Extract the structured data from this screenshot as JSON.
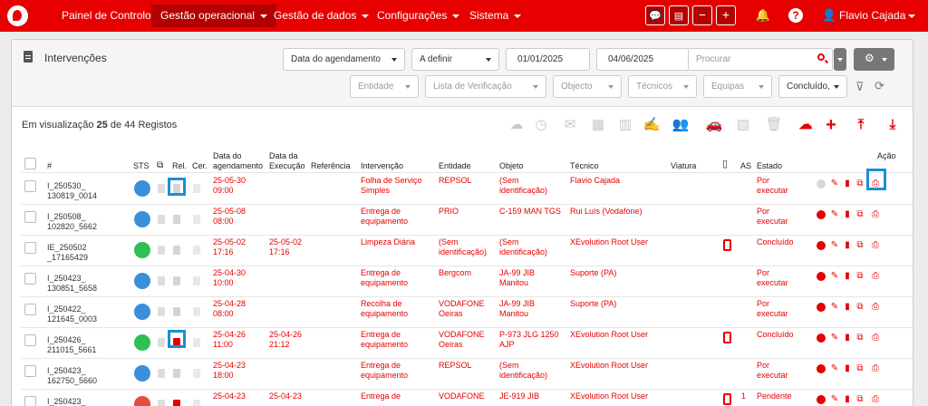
{
  "nav": {
    "items": [
      {
        "label": "Painel de Controlo"
      },
      {
        "label": "Gestão operacional"
      },
      {
        "label": "Gestão de dados"
      },
      {
        "label": "Configurações"
      },
      {
        "label": "Sistema"
      }
    ],
    "user": "Flavio Cajada",
    "help": "?",
    "minus": "−",
    "plus": "+"
  },
  "panel": {
    "title": "Intervenções",
    "filters": {
      "date_type": "Data do agendamento",
      "period": "A definir",
      "date_from": "01/01/2025",
      "date_to": "04/06/2025",
      "search_placeholder": "Procurar",
      "entidade": "Entidade",
      "lista": "Lista de Verificação",
      "objeto": "Objecto",
      "tecnicos": "Técnicos",
      "equipas": "Equipas",
      "estado": "Concluído,"
    }
  },
  "records": {
    "prefix": "Em visualização",
    "count": "25",
    "middle": "de 44 Registos"
  },
  "table": {
    "headers": {
      "num": "#",
      "sts": "STS",
      "rel": "Rel.",
      "cer": "Cer.",
      "agend": [
        "Data do",
        "agendamento"
      ],
      "exec": [
        "Data da",
        "Execução"
      ],
      "ref": "Referência",
      "interv": "Intervenção",
      "entidade": "Entidade",
      "objeto": "Objeto",
      "tecnico": "Técnico",
      "viatura": "Viatura",
      "as": "AS",
      "estado": "Estado",
      "acao": "Ação"
    },
    "rows": [
      {
        "id": [
          "I_250530_",
          "130819_0014"
        ],
        "agend": [
          "25-05-30",
          "09:00"
        ],
        "exec": [
          "",
          ""
        ],
        "interv": [
          "Folha de Serviço",
          "Simples"
        ],
        "entidade": [
          "REPSOL",
          ""
        ],
        "objeto": [
          "(Sem",
          "identificação)"
        ],
        "tecnico": "Flavio Cajada",
        "estado": [
          "Por",
          "executar"
        ],
        "as": "",
        "sts": "blue",
        "rel": "grey",
        "phone": false
      },
      {
        "id": [
          "I_250508_",
          "102820_5662"
        ],
        "agend": [
          "25-05-08",
          "08:00"
        ],
        "exec": [
          "",
          ""
        ],
        "interv": [
          "Entrega de",
          "equipamento"
        ],
        "entidade": [
          "PRIO",
          ""
        ],
        "objeto": [
          "C-159 MAN TGS",
          ""
        ],
        "tecnico": "Rui Luís (Vodafone)",
        "estado": [
          "Por",
          "executar"
        ],
        "as": "",
        "sts": "blue",
        "rel": "grey",
        "phone": false
      },
      {
        "id": [
          "IE_250502",
          "_17165429"
        ],
        "agend": [
          "25-05-02",
          "17:16"
        ],
        "exec": [
          "25-05-02",
          "17:16"
        ],
        "interv": [
          "Limpeza Diária",
          ""
        ],
        "entidade": [
          "(Sem",
          "identificação)"
        ],
        "objeto": [
          "(Sem",
          "identificação)"
        ],
        "tecnico": "XEvolution Root User",
        "estado": [
          "Concluído",
          ""
        ],
        "as": "",
        "sts": "green",
        "rel": "grey",
        "phone": true
      },
      {
        "id": [
          "I_250423_",
          "130851_5658"
        ],
        "agend": [
          "25-04-30",
          "10:00"
        ],
        "exec": [
          "",
          ""
        ],
        "interv": [
          "Entrega de",
          "equipamento"
        ],
        "entidade": [
          "Bergcom",
          ""
        ],
        "objeto": [
          "JA-99 JIB",
          "Manitou"
        ],
        "tecnico": "Suporte (PA)",
        "estado": [
          "Por",
          "executar"
        ],
        "as": "",
        "sts": "blue",
        "rel": "grey",
        "phone": false
      },
      {
        "id": [
          "I_250422_",
          "121645_0003"
        ],
        "agend": [
          "25-04-28",
          "08:00"
        ],
        "exec": [
          "",
          ""
        ],
        "interv": [
          "Recolha de",
          "equipamento"
        ],
        "entidade": [
          "VODAFONE",
          "Oeiras"
        ],
        "objeto": [
          "JA-99 JIB",
          "Manitou"
        ],
        "tecnico": "Suporte (PA)",
        "estado": [
          "Por",
          "executar"
        ],
        "as": "",
        "sts": "blue",
        "rel": "grey",
        "phone": false
      },
      {
        "id": [
          "I_250426_",
          "211015_5661"
        ],
        "agend": [
          "25-04-26",
          "11:00"
        ],
        "exec": [
          "25-04-26",
          "21:12"
        ],
        "interv": [
          "Entrega de",
          "equipamento"
        ],
        "entidade": [
          "VODAFONE",
          "Oeiras"
        ],
        "objeto": [
          "P-973 JLG 1250",
          "AJP"
        ],
        "tecnico": "XEvolution Root User",
        "estado": [
          "Concluído",
          ""
        ],
        "as": "",
        "sts": "green",
        "rel": "red",
        "phone": true
      },
      {
        "id": [
          "I_250423_",
          "162750_5660"
        ],
        "agend": [
          "25-04-23",
          "18:00"
        ],
        "exec": [
          "",
          ""
        ],
        "interv": [
          "Entrega de",
          "equipamento"
        ],
        "entidade": [
          "REPSOL",
          ""
        ],
        "objeto": [
          "(Sem",
          "identificação)"
        ],
        "tecnico": "XEvolution Root User",
        "estado": [
          "Por",
          "executar"
        ],
        "as": "",
        "sts": "blue",
        "rel": "grey",
        "phone": false
      },
      {
        "id": [
          "I_250423_",
          ""
        ],
        "agend": [
          "25-04-23",
          ""
        ],
        "exec": [
          "25-04-23",
          ""
        ],
        "interv": [
          "Entrega de",
          ""
        ],
        "entidade": [
          "VODAFONE",
          ""
        ],
        "objeto": [
          "JE-919 JIB",
          ""
        ],
        "tecnico": "XEvolution Root User",
        "estado": [
          "Pendente",
          ""
        ],
        "as": "1",
        "sts": "red",
        "rel": "red",
        "phone": true
      }
    ]
  }
}
